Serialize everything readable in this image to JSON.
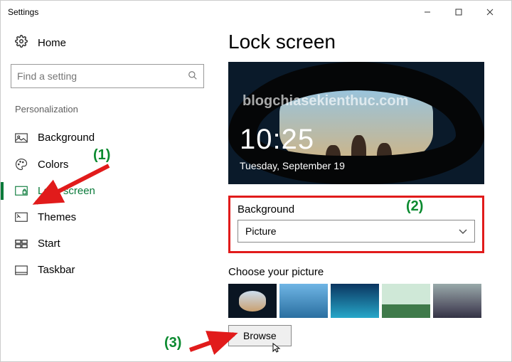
{
  "window": {
    "title": "Settings"
  },
  "sidebar": {
    "home": "Home",
    "search_placeholder": "Find a setting",
    "section": "Personalization",
    "items": [
      {
        "label": "Background"
      },
      {
        "label": "Colors"
      },
      {
        "label": "Lock screen"
      },
      {
        "label": "Themes"
      },
      {
        "label": "Start"
      },
      {
        "label": "Taskbar"
      }
    ]
  },
  "main": {
    "title": "Lock screen",
    "preview": {
      "time": "10:25",
      "date": "Tuesday, September 19",
      "watermark": "blogchiasekienthuc.com"
    },
    "background_label": "Background",
    "background_value": "Picture",
    "choose_label": "Choose your picture",
    "browse": "Browse"
  },
  "annotations": {
    "a1": "(1)",
    "a2": "(2)",
    "a3": "(3)"
  }
}
